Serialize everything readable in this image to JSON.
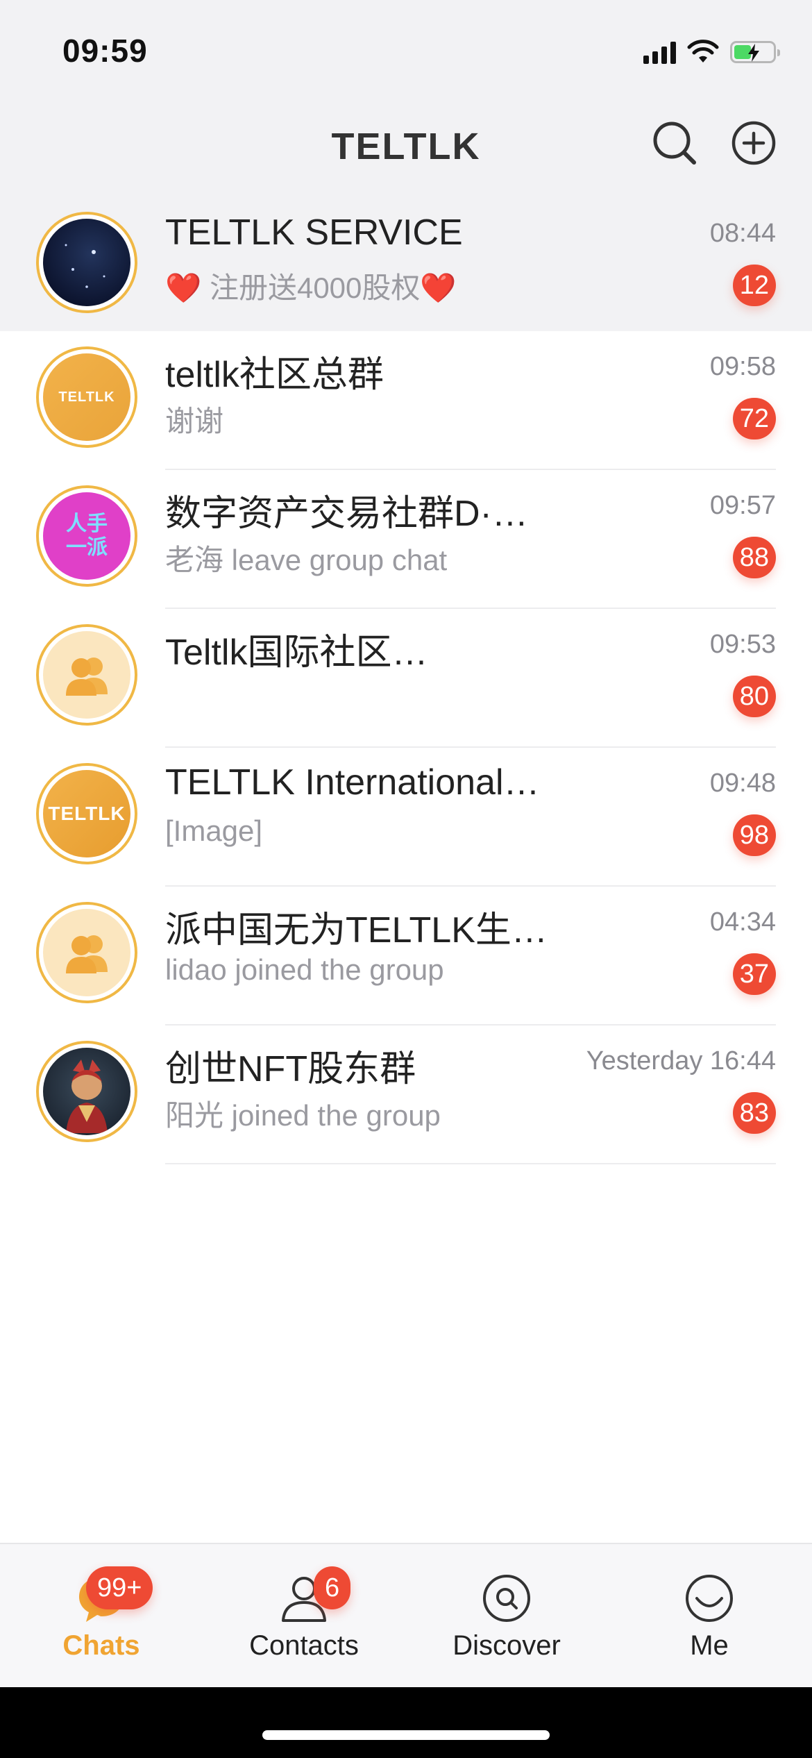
{
  "status_bar": {
    "time": "09:59"
  },
  "header": {
    "title": "TELTLK",
    "search_icon": "search-icon",
    "add_icon": "plus-circle-icon"
  },
  "chats": [
    {
      "name": "TELTLK SERVICE",
      "preview": "❤️ 注册送4000股权❤️",
      "time": "08:44",
      "unread": "12",
      "avatar": "starry-night-avatar"
    },
    {
      "name": "teltlk社区总群",
      "preview": "谢谢",
      "time": "09:58",
      "unread": "72",
      "avatar": "teltlk-logo-avatar"
    },
    {
      "name": "数字资产交易社群D·…",
      "preview": "老海 leave group chat",
      "time": "09:57",
      "unread": "88",
      "avatar": "pink-text-avatar",
      "avatar_text": "人手\n一派"
    },
    {
      "name": "Teltlk国际社区…",
      "preview": "",
      "time": "09:53",
      "unread": "80",
      "avatar": "group-icon"
    },
    {
      "name": "TELTLK International…",
      "preview": "[Image]",
      "time": "09:48",
      "unread": "98",
      "avatar": "teltlk-wordmark-avatar",
      "avatar_text": "TELTLK"
    },
    {
      "name": "派中国无为TELTLK生…",
      "preview": "lidao joined the group",
      "time": "04:34",
      "unread": "37",
      "avatar": "group-icon"
    },
    {
      "name": "创世NFT股东群",
      "preview": "阳光 joined the group",
      "time": "Yesterday 16:44",
      "unread": "83",
      "avatar": "dragon-avatar"
    }
  ],
  "tabbar": {
    "items": [
      {
        "label": "Chats",
        "badge": "99+",
        "icon": "chat-bubble-icon",
        "active": true
      },
      {
        "label": "Contacts",
        "badge": "6",
        "icon": "person-icon",
        "active": false
      },
      {
        "label": "Discover",
        "badge": "",
        "icon": "compass-icon",
        "active": false
      },
      {
        "label": "Me",
        "badge": "",
        "icon": "smile-icon",
        "active": false
      }
    ]
  },
  "colors": {
    "accent": "#f0a432",
    "badge": "#ee4a34",
    "avatar_ring": "#f0b845"
  }
}
